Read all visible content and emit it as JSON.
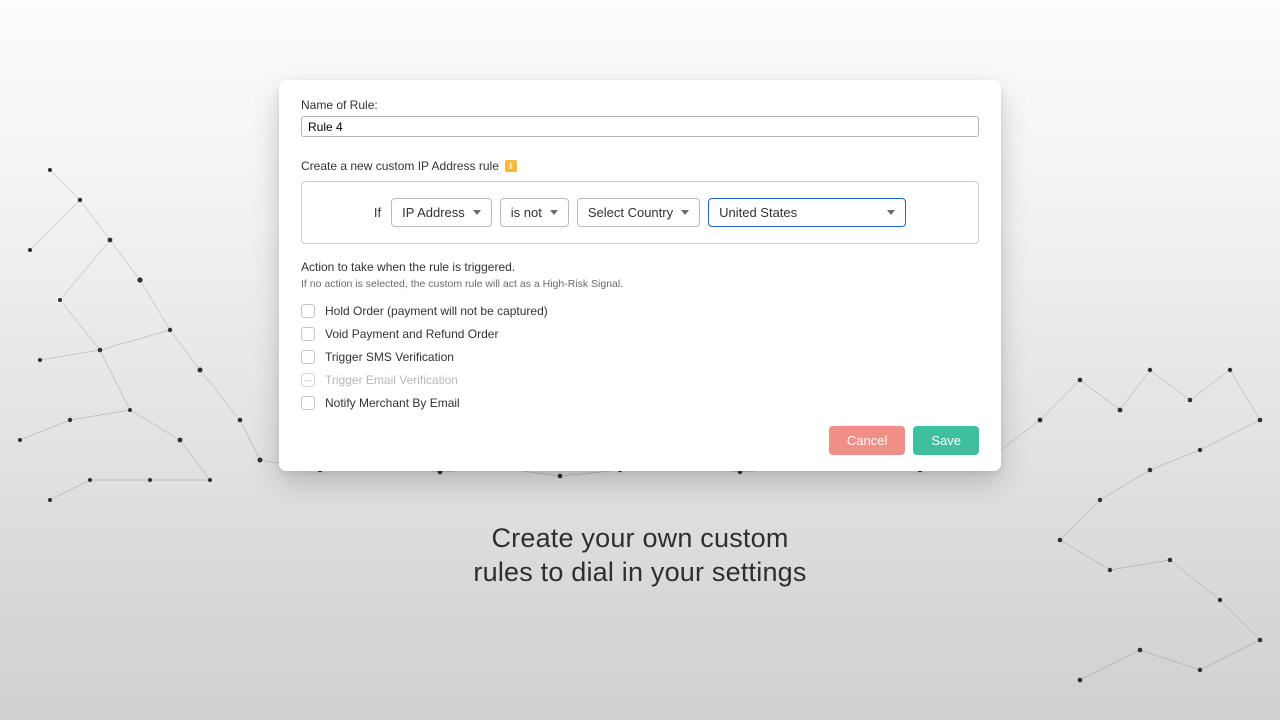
{
  "form": {
    "name_label": "Name of Rule:",
    "name_value": "Rule 4",
    "rule_heading": "Create a new custom IP Address rule",
    "info_badge": "i",
    "if_label": "If",
    "field_select": "IP Address",
    "operator_select": "is not",
    "country_label_select": "Select Country",
    "country_value_select": "United States"
  },
  "actions": {
    "heading": "Action to take when the rule is triggered.",
    "subtext": "If no action is selected, the custom rule will act as a High-Risk Signal.",
    "options": {
      "hold": "Hold Order (payment will not be captured)",
      "void": "Void Payment and Refund Order",
      "sms": "Trigger SMS Verification",
      "email": "Trigger Email Verification",
      "notify": "Notify Merchant By Email"
    }
  },
  "buttons": {
    "cancel": "Cancel",
    "save": "Save"
  },
  "caption": {
    "line1": "Create your own custom",
    "line2": "rules to dial in your settings"
  },
  "colors": {
    "accent_blue": "#2463cf",
    "save_green": "#3fbf9e",
    "cancel_red": "#ef8f86",
    "info_amber": "#f5b93e"
  }
}
